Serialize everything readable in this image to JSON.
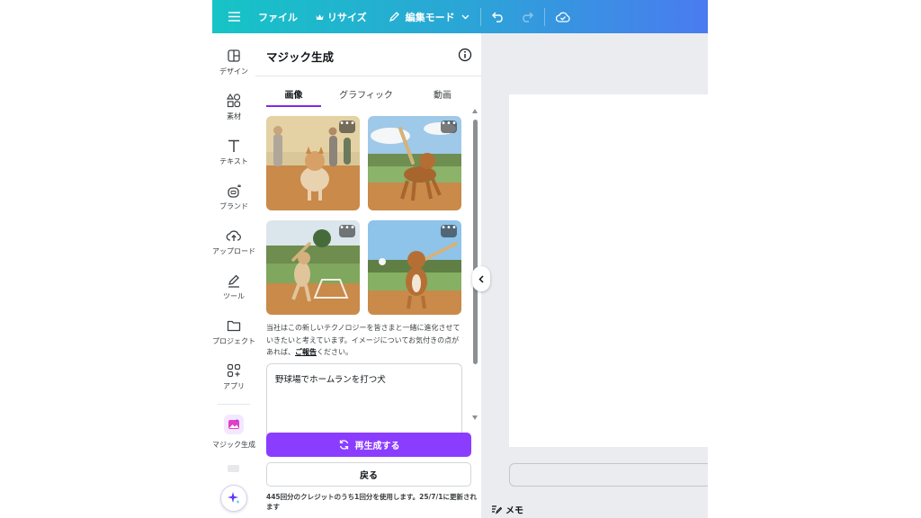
{
  "topbar": {
    "file": "ファイル",
    "resize": "リサイズ",
    "edit_mode": "編集モード"
  },
  "rail": {
    "items": [
      {
        "label": "デザイン"
      },
      {
        "label": "素材"
      },
      {
        "label": "テキスト"
      },
      {
        "label": "ブランド"
      },
      {
        "label": "アップロード"
      },
      {
        "label": "ツール"
      },
      {
        "label": "プロジェクト"
      },
      {
        "label": "アプリ"
      },
      {
        "label": "マジック生成"
      }
    ]
  },
  "panel": {
    "title": "マジック生成",
    "tabs": [
      {
        "label": "画像"
      },
      {
        "label": "グラフィック"
      },
      {
        "label": "動画"
      }
    ],
    "more_label": "•••",
    "disclaimer_before": "当社はこの新しいテクノロジーを皆さまと一緒に進化させていきたいと考えています。イメージについてお気付きの点があれば、",
    "disclaimer_link": "ご報告",
    "disclaimer_after": "ください。",
    "prompt": "野球場でホームランを打つ犬",
    "regenerate": "再生成する",
    "back": "戻る",
    "credits": "445回分のクレジットのうち1回分を使用します。25/7/1に更新されます"
  },
  "canvas": {
    "memo": "メモ"
  },
  "colors": {
    "accent": "#8b3dff",
    "topbar_start": "#16c4c6",
    "topbar_end": "#4a7bf0"
  }
}
